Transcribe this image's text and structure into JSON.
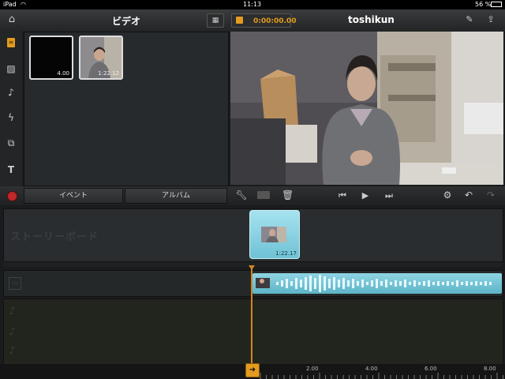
{
  "status_bar": {
    "device": "iPad",
    "time": "11:13",
    "battery": "56 %"
  },
  "toolbar": {
    "title": "ビデオ",
    "timecode": "0:00:00.00",
    "project_name": "toshikun"
  },
  "browser": {
    "clips": [
      {
        "duration": "4.00",
        "kind": "black"
      },
      {
        "duration": "1:22.12",
        "kind": "person"
      }
    ]
  },
  "event_bar": {
    "event_label": "イベント",
    "album_label": "アルバム"
  },
  "storyboard": {
    "label": "ストーリーボード",
    "clip_duration": "1:22.17"
  },
  "ruler": {
    "ticks": [
      "2.00",
      "4.00",
      "6.00",
      "8.00"
    ]
  },
  "colors": {
    "accent": "#e39b20",
    "clip": "#7fcfe0",
    "record": "#c0282a"
  }
}
